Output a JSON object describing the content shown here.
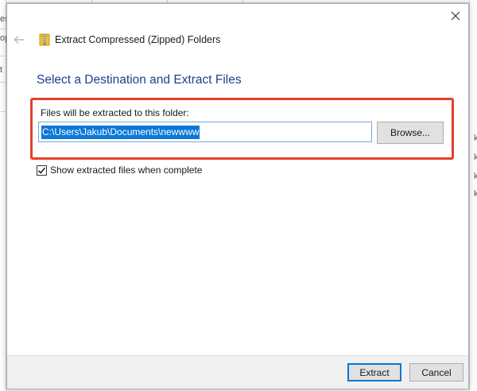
{
  "dialog": {
    "title": "Extract Compressed (Zipped) Folders",
    "heading": "Select a Destination and Extract Files",
    "destination_label": "Files will be extracted to this folder:",
    "destination_path": "C:\\Users\\Jakub\\Documents\\newwww",
    "browse_label": "Browse...",
    "show_files_label": "Show extracted files when complete",
    "show_files_checked": true,
    "extract_label": "Extract",
    "cancel_label": "Cancel"
  },
  "background": {
    "left_fragments": [
      "es",
      "op",
      "t"
    ],
    "right_fragments": [
      "k",
      "k",
      "k",
      "k"
    ]
  },
  "icons": {
    "close": "close-icon",
    "back": "back-arrow-icon",
    "zip": "zip-folder-icon",
    "check": "checkmark-icon"
  },
  "colors": {
    "heading": "#1e3f8a",
    "highlight_frame": "#e4402a",
    "selection": "#0a78d7",
    "default_button_border": "#0078d7"
  }
}
